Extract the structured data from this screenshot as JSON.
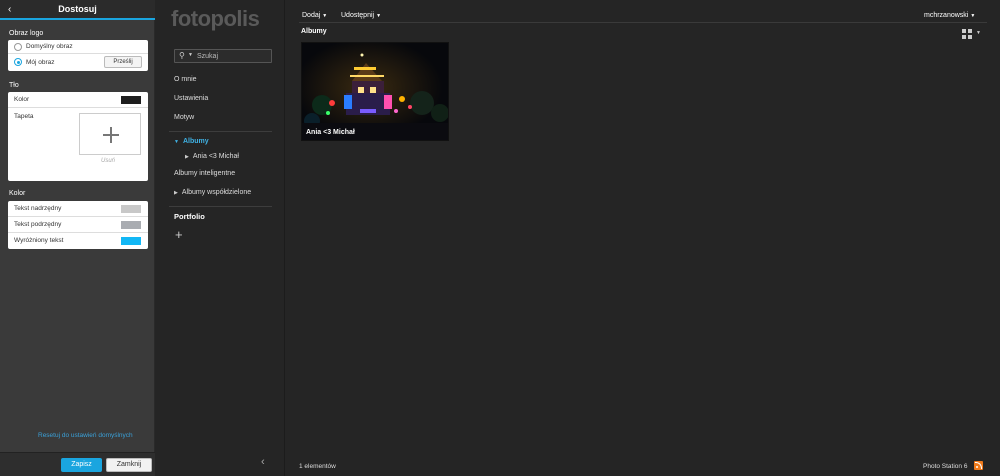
{
  "panel": {
    "title": "Dostosuj",
    "logo_section": "Obraz logo",
    "logo_options": [
      "Domyślny obraz",
      "Mój obraz"
    ],
    "logo_selected": "Mój obraz",
    "upload_label": "Prześlij",
    "bg_section": "Tło",
    "bg_color_label": "Kolor",
    "bg_color": "#1e1e1e",
    "wallpaper_label": "Tapeta",
    "remove_label": "Usuń",
    "color_section": "Kolor",
    "color_rows": [
      {
        "label": "Tekst nadrzędny",
        "color": "#c8c8c8"
      },
      {
        "label": "Tekst podrzędny",
        "color": "#a9acb1"
      },
      {
        "label": "Wyróżniony tekst",
        "color": "#12b7f5"
      }
    ],
    "reset_label": "Resetuj do ustawień domyślnych",
    "save_label": "Zapisz",
    "close_label": "Zamknij"
  },
  "nav": {
    "logo_text": "fotopolis",
    "search_placeholder": "Szukaj",
    "items": [
      "O mnie",
      "Ustawienia",
      "Motyw"
    ],
    "albums_label": "Albumy",
    "album_child": "Ania <3 Michał",
    "smart_albums": "Albumy inteligentne",
    "shared_albums": "Albumy współdzielone",
    "portfolio": "Portfolio"
  },
  "topbar": {
    "add_menu": "Dodaj",
    "share_menu": "Udostępnij",
    "user_menu": "mchrzanowski"
  },
  "main": {
    "breadcrumb": "Albumy",
    "albums": [
      {
        "title": "Ania <3 Michał"
      }
    ],
    "count_label": "1 elementów",
    "brand_label": "Photo Station 6"
  },
  "colors": {
    "accent": "#1aa5df",
    "rss": "#f07a1a"
  }
}
